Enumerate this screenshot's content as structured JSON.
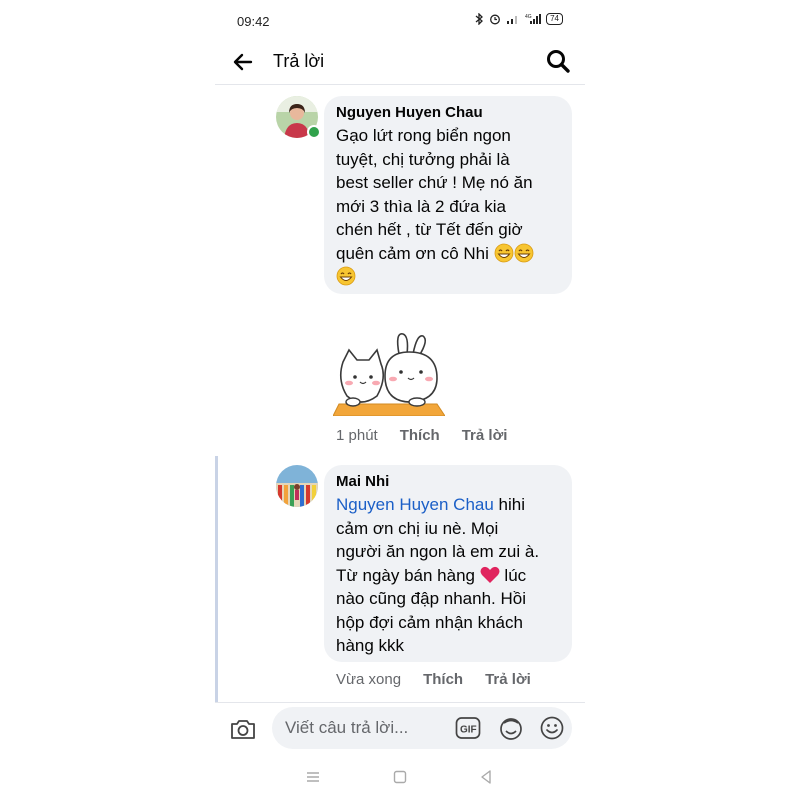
{
  "status_bar": {
    "time": "09:42",
    "battery": "74"
  },
  "header": {
    "title": "Trả lời",
    "back_icon": "arrow-left-icon",
    "search_icon": "search-icon"
  },
  "comments": [
    {
      "author": "Nguyen Huyen Chau",
      "text": "Gạo lứt rong biển ngon\ntuyệt, chị tưởng phải là\nbest seller chứ ! Mẹ nó ăn\nmới 3 thìa là 2 đứa kia\nchén hết , từ Tết đến giờ\nquên cảm ơn cô Nhi ",
      "emojis": "😁😁😁",
      "sticker": "cat-and-bunny-sticker",
      "online": true,
      "meta": {
        "time": "1 phút",
        "like": "Thích",
        "reply": "Trả lời"
      }
    },
    {
      "author": "Mai Nhi",
      "mention": "Nguyen Huyen Chau",
      "text_part1": " hihi\ncảm ơn chị iu nè. Mọi\nngười ăn ngon là em zui à.\nTừ ngày bán hàng ",
      "heart": "heart-emoji",
      "text_part2": " lúc\nnào cũng đập nhanh. Hồi\nhộp đợi cảm nhận khách\nhàng kkk",
      "meta": {
        "time": "Vừa xong",
        "like": "Thích",
        "reply": "Trả lời"
      }
    }
  ],
  "composer": {
    "placeholder": "Viết câu trả lời...",
    "camera_icon": "camera-icon",
    "gif_icon": "gif-icon",
    "sticker_icon": "sticker-icon",
    "emoji_icon": "smile-icon"
  },
  "nav_bar": {
    "icons": [
      "menu-icon",
      "home-icon",
      "back-icon"
    ]
  },
  "colors": {
    "mention": "#1b5fc7",
    "bubble": "#f0f2f5",
    "meta": "#65676b",
    "online": "#31a24c",
    "heart": "#e0245e"
  }
}
